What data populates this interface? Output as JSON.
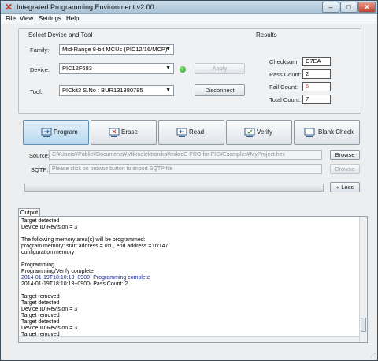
{
  "window": {
    "title": "Integrated Programming Environment v2.00",
    "icon": "x-logo-icon"
  },
  "menu": [
    "File",
    "View",
    "Settings",
    "Help"
  ],
  "device_group": {
    "legend": "Select Device and Tool",
    "family_label": "Family:",
    "family_value": "Mid-Range 8-bit MCUs (PIC12/16/MCP)",
    "device_label": "Device:",
    "device_value": "PIC12F683",
    "apply_label": "Apply",
    "tool_label": "Tool:",
    "tool_value": "PICkit3 S.No : BUR131880785",
    "disconnect_label": "Disconnect",
    "status_color": "#1f9e22"
  },
  "results": {
    "legend": "Results",
    "checksum_label": "Checksum:",
    "checksum_value": "C7EA",
    "pass_label": "Pass Count:",
    "pass_value": "2",
    "fail_label": "Fail Count:",
    "fail_value": "5",
    "total_label": "Total Count:",
    "total_value": "7"
  },
  "toolbar": {
    "program": "Program",
    "erase": "Erase",
    "read": "Read",
    "verify": "Verify",
    "blank_check": "Blank Check"
  },
  "source": {
    "label": "Source:",
    "value": "C:¥Users¥Public¥Documents¥Mikroelektronika¥mikroC PRO for PIC¥Examples¥MyProject.hex",
    "browse": "Browse"
  },
  "sqtp": {
    "label": "SQTP:",
    "placeholder": "Please click on browse button to import SQTP file",
    "browse": "Browse"
  },
  "less_label": "Less",
  "output": {
    "tab": "Output",
    "lines": [
      {
        "text": "Target detected",
        "blue": false
      },
      {
        "text": "Device ID Revision = 3",
        "blue": false
      },
      {
        "text": "",
        "blue": false
      },
      {
        "text": "The following memory area(s) will be programmed:",
        "blue": false
      },
      {
        "text": "program memory: start address = 0x0, end address = 0x147",
        "blue": false
      },
      {
        "text": "configuration memory",
        "blue": false
      },
      {
        "text": "",
        "blue": false
      },
      {
        "text": "Programming...",
        "blue": false
      },
      {
        "text": "Programming/Verify complete",
        "blue": false
      },
      {
        "text": "2014-01-19T18:10:13+0900- Programming complete",
        "blue": true
      },
      {
        "text": "2014-01-19T18:10:13+0900- Pass Count: 2",
        "blue": false
      },
      {
        "text": "",
        "blue": false
      },
      {
        "text": "Target removed",
        "blue": false
      },
      {
        "text": "Target detected",
        "blue": false
      },
      {
        "text": "Device ID Revision = 3",
        "blue": false
      },
      {
        "text": "Target removed",
        "blue": false
      },
      {
        "text": "Target detected",
        "blue": false
      },
      {
        "text": "Device ID Revision = 3",
        "blue": false
      },
      {
        "text": "Target removed",
        "blue": false
      }
    ]
  }
}
